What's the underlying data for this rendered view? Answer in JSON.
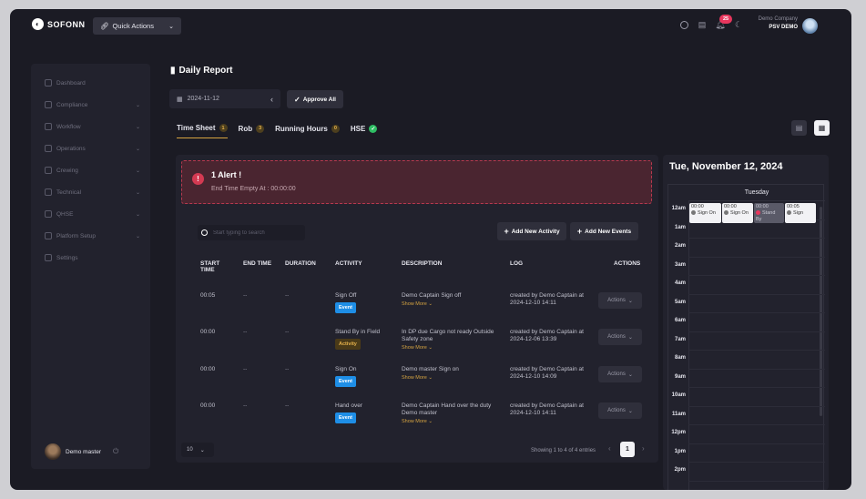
{
  "topbar": {
    "brand": "SOFONN",
    "quick_actions": "Quick Actions",
    "notif_count": "25",
    "company_name": "Demo Company",
    "vessel": "PSV DEMO"
  },
  "sidebar": {
    "items": [
      {
        "label": "Dashboard",
        "chevron": false
      },
      {
        "label": "Compliance",
        "chevron": true
      },
      {
        "label": "Workflow",
        "chevron": true
      },
      {
        "label": "Operations",
        "chevron": true
      },
      {
        "label": "Crewing",
        "chevron": true
      },
      {
        "label": "Technical",
        "chevron": true
      },
      {
        "label": "QHSE",
        "chevron": true
      },
      {
        "label": "Platform Setup",
        "chevron": true
      },
      {
        "label": "Settings",
        "chevron": false
      }
    ],
    "user_name": "Demo master"
  },
  "page": {
    "title": "Daily Report",
    "date": "2024-11-12",
    "approve_all": "Approve All"
  },
  "tabs": [
    {
      "label": "Time Sheet",
      "count": "1",
      "active": true
    },
    {
      "label": "Rob",
      "count": "3",
      "active": false
    },
    {
      "label": "Running Hours",
      "count": "0",
      "active": false
    },
    {
      "label": "HSE",
      "count": "✓",
      "active": false
    }
  ],
  "alert": {
    "title": "1 Alert !",
    "message": "End Time Empty At : 00:00:00"
  },
  "toolbar": {
    "search_placeholder": "Start typing to search",
    "add_activity": "Add New Activity",
    "add_events": "Add New Events"
  },
  "table": {
    "headers": [
      "START TIME",
      "END TIME",
      "DURATION",
      "ACTIVITY",
      "DESCRIPTION",
      "LOG",
      "ACTIONS"
    ],
    "show_more": "Show More",
    "actions_label": "Actions",
    "rows": [
      {
        "start": "00:05",
        "end": "--",
        "duration": "--",
        "activity": "Sign Off",
        "tag": "Event",
        "tag_type": "event",
        "description": "Demo Captain Sign off",
        "log": "created by Demo Captain at 2024-12-10 14:11"
      },
      {
        "start": "00:00",
        "end": "--",
        "duration": "--",
        "activity": "Stand By in Field",
        "tag": "Activity",
        "tag_type": "activity",
        "description": "In DP due Cargo not ready Outside Safety zone",
        "log": "created by Demo Captain at 2024-12-06 13:39"
      },
      {
        "start": "00:00",
        "end": "--",
        "duration": "--",
        "activity": "Sign On",
        "tag": "Event",
        "tag_type": "event",
        "description": "Demo master Sign on",
        "log": "created by Demo Captain at 2024-12-10 14:09"
      },
      {
        "start": "00:00",
        "end": "--",
        "duration": "--",
        "activity": "Hand over",
        "tag": "Event",
        "tag_type": "event",
        "description": "Demo Captain Hand over the duty Demo master",
        "log": "created by Demo Captain at 2024-12-10 14:11"
      }
    ],
    "per_page": "10",
    "showing": "Showing 1 to 4 of 4 entries",
    "page": "1"
  },
  "calendar": {
    "title": "Tue, November 12, 2024",
    "day": "Tuesday",
    "hours": [
      "12am",
      "1am",
      "2am",
      "3am",
      "4am",
      "5am",
      "6am",
      "7am",
      "8am",
      "9am",
      "10am",
      "11am",
      "12pm",
      "1pm",
      "2pm"
    ],
    "events": [
      {
        "time": "00:00",
        "label": "Sign On",
        "faded": false,
        "dot": "grey"
      },
      {
        "time": "00:00",
        "label": "Sign On",
        "faded": false,
        "dot": "grey"
      },
      {
        "time": "00:00",
        "label": "Stand By",
        "faded": true,
        "dot": "red"
      },
      {
        "time": "00:05",
        "label": "Sign",
        "faded": false,
        "dot": "grey"
      }
    ]
  }
}
